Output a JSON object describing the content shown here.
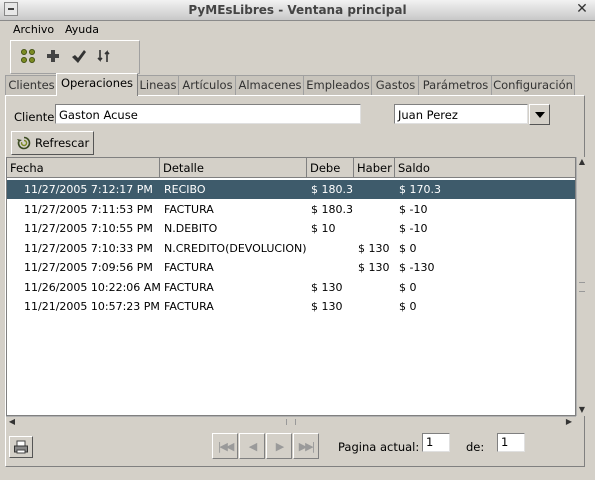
{
  "window": {
    "title": "PyMEsLibres - Ventana principal",
    "close_glyph": "✕"
  },
  "menu": [
    {
      "label": "Archivo"
    },
    {
      "label": "Ayuda"
    }
  ],
  "toolbar": {
    "icons": [
      "grid-icon",
      "add-icon",
      "check-icon",
      "sort-icon"
    ]
  },
  "tabs": [
    {
      "label": "Clientes"
    },
    {
      "label": "Operaciones"
    },
    {
      "label": "Lineas"
    },
    {
      "label": "Artículos"
    },
    {
      "label": "Almacenes"
    },
    {
      "label": "Empleados"
    },
    {
      "label": "Gastos"
    },
    {
      "label": "Parámetros"
    },
    {
      "label": "Configuración"
    }
  ],
  "active_tab": "Operaciones",
  "filter": {
    "cliente_label": "Cliente",
    "cliente_value": "Gaston Acuse",
    "empleado_value": "Juan Perez",
    "refresh_label": "Refrescar"
  },
  "table": {
    "columns": [
      "Fecha",
      "Detalle",
      "Debe",
      "Haber",
      "Saldo"
    ],
    "rows": [
      {
        "fecha": "11/27/2005 7:12:17 PM",
        "detalle": "RECIBO",
        "debe": "$ 180.3",
        "haber": "",
        "saldo": "$ 170.3",
        "selected": true
      },
      {
        "fecha": "11/27/2005 7:11:53 PM",
        "detalle": "FACTURA",
        "debe": "$ 180.3",
        "haber": "",
        "saldo": "$ -10"
      },
      {
        "fecha": "11/27/2005 7:10:55 PM",
        "detalle": "N.DEBITO",
        "debe": "$ 10",
        "haber": "",
        "saldo": "$ -10"
      },
      {
        "fecha": "11/27/2005 7:10:33 PM",
        "detalle": "N.CREDITO(DEVOLUCION)",
        "debe": "",
        "haber": "$ 130",
        "saldo": "$ 0"
      },
      {
        "fecha": "11/27/2005 7:09:56 PM",
        "detalle": "FACTURA",
        "debe": "",
        "haber": "$ 130",
        "saldo": "$ -130"
      },
      {
        "fecha": "11/26/2005 10:22:06 AM",
        "detalle": "FACTURA",
        "debe": "$ 130",
        "haber": "",
        "saldo": "$ 0"
      },
      {
        "fecha": "11/21/2005 10:57:23 PM",
        "detalle": "FACTURA",
        "debe": "$ 130",
        "haber": "",
        "saldo": "$ 0"
      }
    ]
  },
  "pagination": {
    "current_label": "Pagina actual:",
    "current_value": "1",
    "of_label": "de:",
    "total_value": "1"
  },
  "colors": {
    "selection": "#3e5b6b"
  }
}
